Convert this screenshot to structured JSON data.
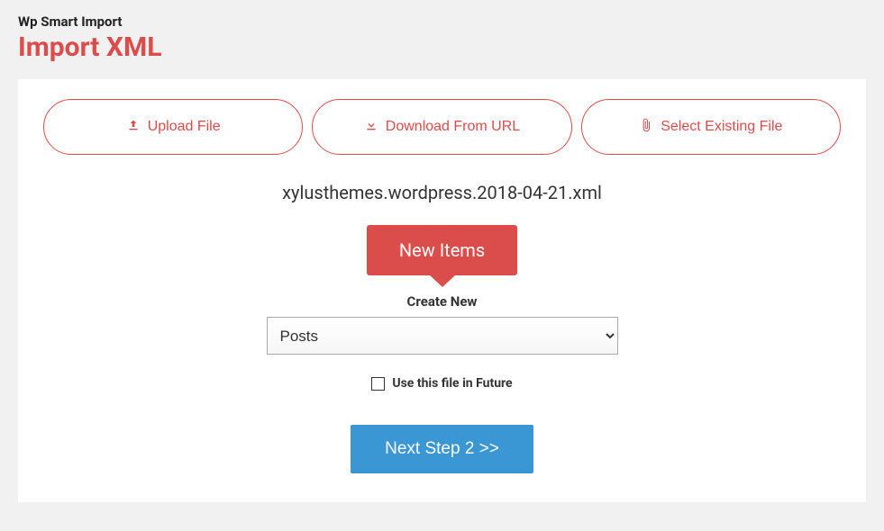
{
  "header": {
    "plugin_name": "Wp Smart Import",
    "page_title": "Import XML"
  },
  "tabs": {
    "upload": "Upload File",
    "download": "Download From URL",
    "select_existing": "Select Existing File"
  },
  "file": {
    "name": "xylusthemes.wordpress.2018-04-21.xml"
  },
  "new_items": {
    "badge": "New Items",
    "create_label": "Create New",
    "dropdown_value": "Posts"
  },
  "options": {
    "future_file_label": "Use this file in Future"
  },
  "actions": {
    "next_button": "Next Step 2 >>"
  }
}
